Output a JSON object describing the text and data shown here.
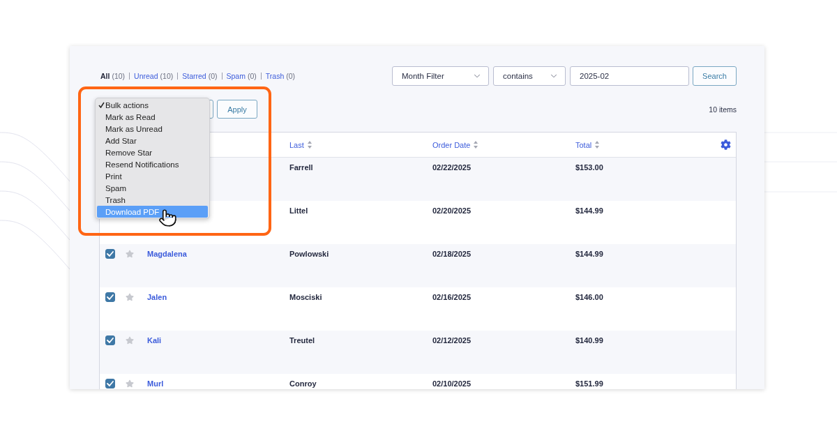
{
  "status_filters": [
    {
      "label": "All",
      "count": "(10)",
      "selected": true
    },
    {
      "label": "Unread",
      "count": "(10)",
      "selected": false
    },
    {
      "label": "Starred",
      "count": "(0)",
      "selected": false
    },
    {
      "label": "Spam",
      "count": "(0)",
      "selected": false
    },
    {
      "label": "Trash",
      "count": "(0)",
      "selected": false
    }
  ],
  "filter_bar": {
    "field_select": "Month Filter",
    "operator_select": "contains",
    "value": "2025-02",
    "search_button": "Search"
  },
  "bulk_actions": {
    "apply_button": "Apply",
    "menu": {
      "items": [
        {
          "label": "Bulk actions",
          "selected": true,
          "highlighted": false
        },
        {
          "label": "Mark as Read",
          "selected": false,
          "highlighted": false
        },
        {
          "label": "Mark as Unread",
          "selected": false,
          "highlighted": false
        },
        {
          "label": "Add Star",
          "selected": false,
          "highlighted": false
        },
        {
          "label": "Remove Star",
          "selected": false,
          "highlighted": false
        },
        {
          "label": "Resend Notifications",
          "selected": false,
          "highlighted": false
        },
        {
          "label": "Print",
          "selected": false,
          "highlighted": false
        },
        {
          "label": "Spam",
          "selected": false,
          "highlighted": false
        },
        {
          "label": "Trash",
          "selected": false,
          "highlighted": false
        },
        {
          "label": "Download PDF",
          "selected": false,
          "highlighted": true
        }
      ]
    }
  },
  "item_count": "10 items",
  "table": {
    "columns": [
      {
        "label": "Last"
      },
      {
        "label": "Order Date"
      },
      {
        "label": "Total"
      }
    ],
    "rows": [
      {
        "last": "Farrell",
        "order_date": "02/22/2025",
        "total": "$153.00"
      },
      {
        "last": "Littel",
        "order_date": "02/20/2025",
        "total": "$144.99"
      },
      {
        "checked": true,
        "starred": false,
        "first": "Magdalena",
        "last": "Powlowski",
        "order_date": "02/18/2025",
        "total": "$144.99"
      },
      {
        "checked": true,
        "starred": false,
        "first": "Jalen",
        "last": "Mosciski",
        "order_date": "02/16/2025",
        "total": "$146.00"
      },
      {
        "checked": true,
        "starred": false,
        "first": "Kali",
        "last": "Treutel",
        "order_date": "02/12/2025",
        "total": "$140.99"
      },
      {
        "checked": true,
        "starred": false,
        "first": "Murl",
        "last": "Conroy",
        "order_date": "02/10/2025",
        "total": "$151.99"
      }
    ]
  }
}
